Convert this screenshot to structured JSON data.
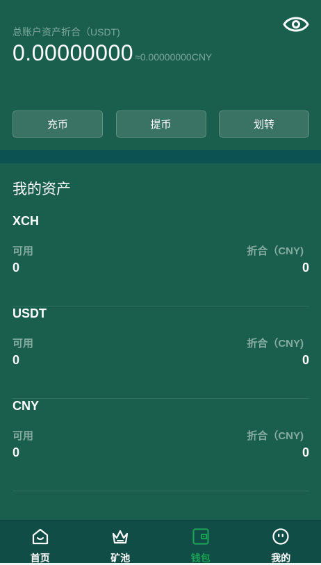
{
  "header": {
    "total_label": "总账户资产折合（USDT)",
    "balance": "0.00000000",
    "balance_approx": "≈0.00000000CNY",
    "eye_icon": "eye-icon"
  },
  "actions": [
    {
      "label": "充币"
    },
    {
      "label": "提币"
    },
    {
      "label": "划转"
    }
  ],
  "assets": {
    "title": "我的资产",
    "items": [
      {
        "name": "XCH",
        "available_label": "可用",
        "converted_label": "折合（CNY)",
        "available": "0",
        "converted": "0"
      },
      {
        "name": "USDT",
        "available_label": "可用",
        "converted_label": "折合（CNY)",
        "available": "0",
        "converted": "0"
      },
      {
        "name": "CNY",
        "available_label": "可用",
        "converted_label": "折合（CNY)",
        "available": "0",
        "converted": "0"
      }
    ]
  },
  "tabbar": {
    "active_color": "#1aa052",
    "items": [
      {
        "label": "首页",
        "icon": "home-icon"
      },
      {
        "label": "矿池",
        "icon": "crown-icon"
      },
      {
        "label": "钱包",
        "icon": "wallet-icon",
        "active": true
      },
      {
        "label": "我的",
        "icon": "profile-icon"
      }
    ]
  }
}
